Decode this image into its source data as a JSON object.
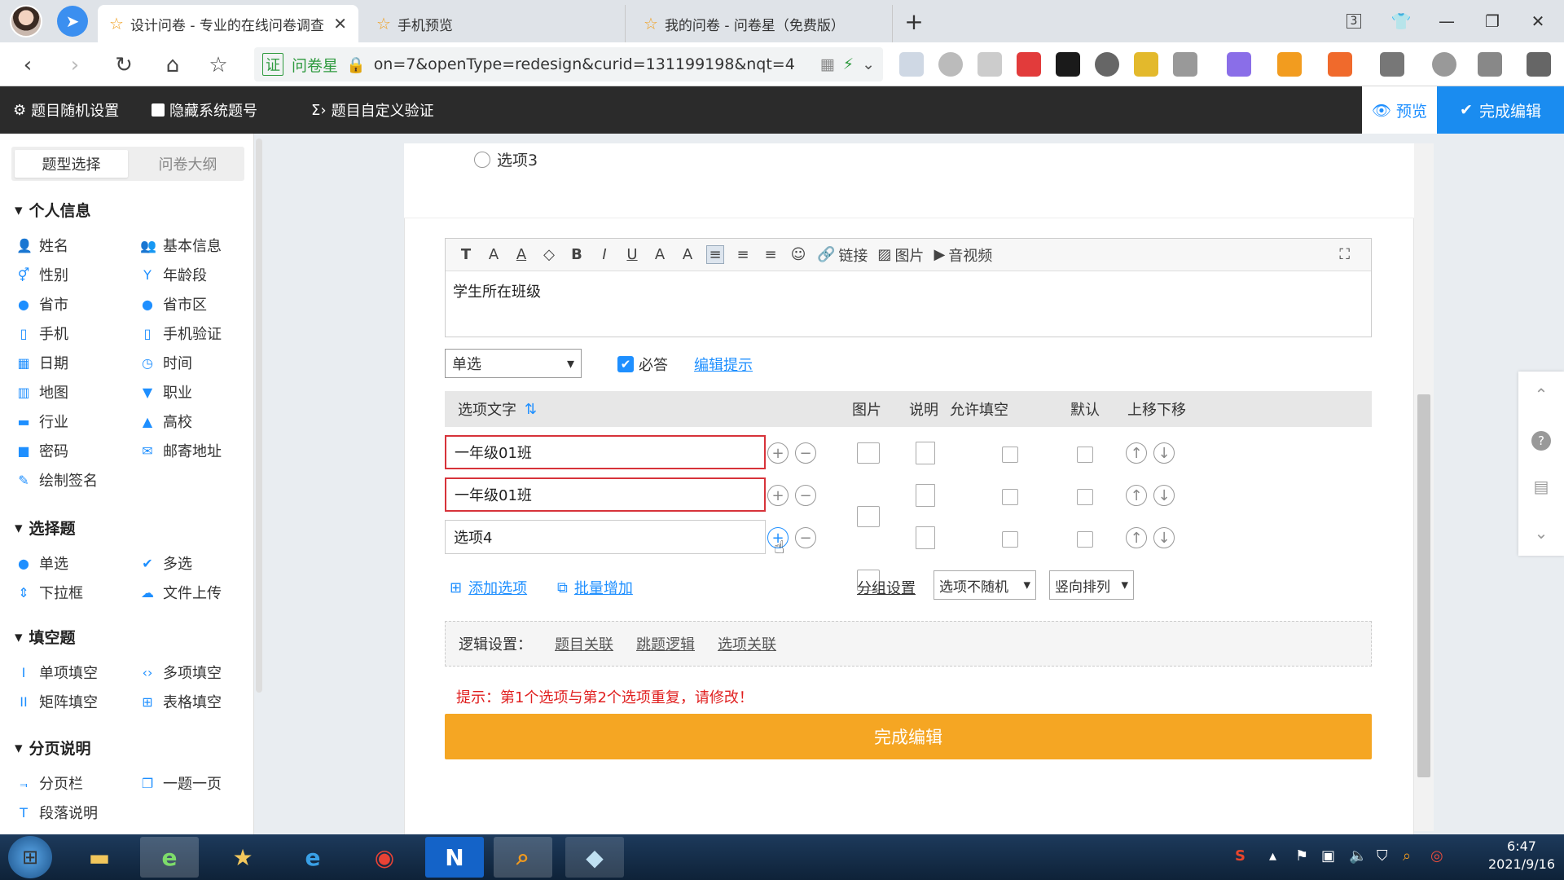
{
  "browser": {
    "tabs": [
      {
        "label": "设计问卷 - 专业的在线问卷调查",
        "active": true
      },
      {
        "label": "手机预览",
        "active": false
      },
      {
        "label": "我的问卷 - 问卷星（免费版）",
        "active": false
      }
    ],
    "new_tab": "+",
    "tab_count": "3",
    "url_badge": "证",
    "url_site": "问卷星",
    "url": "on=7&openType=redesign&curid=131199198&nqt=4"
  },
  "editor_bar": {
    "random": "题目随机设置",
    "hide_no": "隐藏系统题号",
    "custom_verify": "题目自定义验证",
    "preview": "预览",
    "finish": "完成编辑"
  },
  "left_panel": {
    "tabs": [
      "题型选择",
      "问卷大纲"
    ],
    "sections": [
      {
        "title": "个人信息",
        "items": [
          "姓名",
          "基本信息",
          "性别",
          "年龄段",
          "省市",
          "省市区",
          "手机",
          "手机验证",
          "日期",
          "时间",
          "地图",
          "职业",
          "行业",
          "高校",
          "密码",
          "邮寄地址",
          "绘制签名"
        ]
      },
      {
        "title": "选择题",
        "items": [
          "单选",
          "多选",
          "下拉框",
          "文件上传"
        ]
      },
      {
        "title": "填空题",
        "items": [
          "单项填空",
          "多项填空",
          "矩阵填空",
          "表格填空"
        ]
      },
      {
        "title": "分页说明",
        "items": [
          "分页栏",
          "一题一页",
          "段落说明"
        ]
      }
    ]
  },
  "question": {
    "prev_option": "选项3",
    "toolbar": [
      "T",
      "A",
      "A",
      "◇",
      "B",
      "I",
      "U",
      "A",
      "A",
      "≡",
      "≡",
      "≡",
      "☺"
    ],
    "toolbar_link": "链接",
    "toolbar_image": "图片",
    "toolbar_media": "音视频",
    "title_text": "学生所在班级",
    "type": "单选",
    "required": "必答",
    "edit_hint": "编辑提示",
    "headers": {
      "text": "选项文字",
      "image": "图片",
      "desc": "说明",
      "fill": "允许填空",
      "default": "默认",
      "move": "上移下移"
    },
    "options": [
      "一年级01班",
      "一年级01班",
      "选项4"
    ],
    "add_option": "添加选项",
    "batch_add": "批量增加",
    "group_settings": "分组设置",
    "random_select": "选项不随机",
    "layout_select": "竖向排列",
    "logic_label": "逻辑设置：",
    "logic_links": [
      "题目关联",
      "跳题逻辑",
      "选项关联"
    ],
    "warning": "提示：第1个选项与第2个选项重复，请修改！",
    "finish": "完成编辑"
  },
  "taskbar": {
    "time": "6:47",
    "date": "2021/9/16",
    "n_label": "N"
  }
}
